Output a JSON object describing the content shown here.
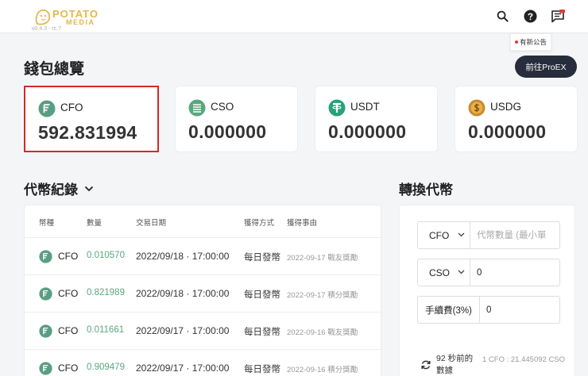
{
  "header": {
    "logo_top": "POTATO",
    "logo_bottom": "MEDIA",
    "version": "v0.4.3 - rc.7",
    "announcement": "有新公告",
    "proex_button": "前往ProEX"
  },
  "page_title": "錢包總覽",
  "wallets": [
    {
      "name": "CFO",
      "balance": "592.831994",
      "icon": "cfo-coin-icon",
      "color": "#5a9e82"
    },
    {
      "name": "CSO",
      "balance": "0.000000",
      "icon": "cso-coin-icon",
      "color": "#59a77e"
    },
    {
      "name": "USDT",
      "balance": "0.000000",
      "icon": "tether-icon",
      "color": "#26a17b"
    },
    {
      "name": "USDG",
      "balance": "0.000000",
      "icon": "usdg-coin-icon",
      "color": "#c98b2c"
    }
  ],
  "records": {
    "title": "代幣紀錄",
    "headers": [
      "幣種",
      "數量",
      "交易日期",
      "獲得方式",
      "獲得事由"
    ],
    "rows": [
      {
        "coin": "CFO",
        "amount": "0.010570",
        "date": "2022/09/18 · 17:00:00",
        "method": "每日發幣",
        "reason": "2022-09-17 戰友獎勵"
      },
      {
        "coin": "CFO",
        "amount": "0.821989",
        "date": "2022/09/18 · 17:00:00",
        "method": "每日發幣",
        "reason": "2022-09-17 積分獎勵"
      },
      {
        "coin": "CFO",
        "amount": "0.011661",
        "date": "2022/09/17 · 17:00:00",
        "method": "每日發幣",
        "reason": "2022-09-16 戰友獎勵"
      },
      {
        "coin": "CFO",
        "amount": "0.909479",
        "date": "2022/09/17 · 17:00:00",
        "method": "每日發幣",
        "reason": "2022-09-16 積分獎勵"
      }
    ]
  },
  "convert": {
    "title": "轉換代幣",
    "from_coin": "CFO",
    "from_placeholder": "代幣數量 (最小單",
    "to_coin": "CSO",
    "to_value": "0",
    "fee_label": "手續費(3%)",
    "fee_value": "0",
    "updated": "92 秒前的數據",
    "rate": "1 CFO : 21.445092 CSO"
  }
}
